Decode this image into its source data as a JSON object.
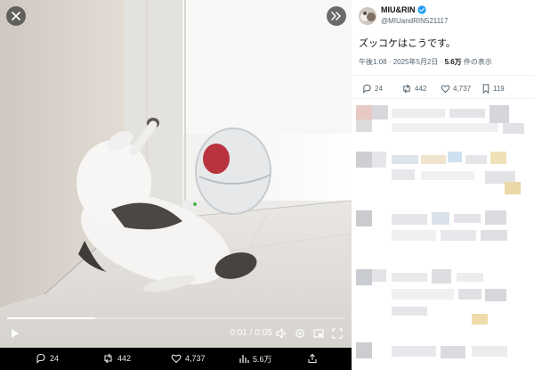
{
  "player": {
    "time_display": "0:01 / 0:05",
    "progress": 0.26
  },
  "media_actions": {
    "replies": "24",
    "reposts": "442",
    "likes": "4,737",
    "views": "5.6万"
  },
  "tweet": {
    "author_name": "MIU&RIN",
    "verified": true,
    "handle": "@MIUandRIN521117",
    "text": "ズッコケはこうです。",
    "time": "午後1:08",
    "separator": "·",
    "date": "2025年5月2日",
    "views_count": "5.6万",
    "views_suffix": "件の表示",
    "stats": {
      "replies": "24",
      "reposts": "442",
      "likes": "4,737",
      "bookmarks": "119"
    }
  },
  "colors": {
    "verified_blue": "#1d9bf0",
    "media_bg": "#000000",
    "panel_bg": "#ffffff",
    "secondary_text": "#536471"
  },
  "icons": [
    "close-icon",
    "chevron-right-icon",
    "play-icon",
    "volume-icon",
    "settings-icon",
    "picture-in-picture-icon",
    "fullscreen-icon",
    "reply-icon",
    "repost-icon",
    "like-icon",
    "views-icon",
    "share-icon",
    "bookmark-icon",
    "verified-badge-icon"
  ]
}
